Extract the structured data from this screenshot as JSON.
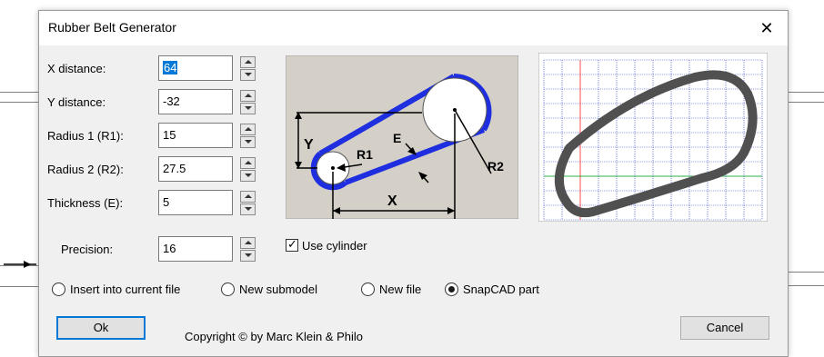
{
  "dialog": {
    "title": "Rubber Belt Generator",
    "close_glyph": "✕"
  },
  "fields": {
    "x_distance": {
      "label": "X distance:",
      "value": "64"
    },
    "y_distance": {
      "label": "Y distance:",
      "value": "-32"
    },
    "radius1": {
      "label": "Radius 1 (R1):",
      "value": "15"
    },
    "radius2": {
      "label": "Radius 2 (R2):",
      "value": "27.5"
    },
    "thickness": {
      "label": "Thickness (E):",
      "value": "5"
    },
    "precision": {
      "label": "Precision:",
      "value": "16"
    }
  },
  "diagram": {
    "label_y": "Y",
    "label_x": "X",
    "label_r1": "R1",
    "label_r2": "R2",
    "label_e": "E",
    "belt_color": "#1f2fe0",
    "background_color": "#d4d0c8"
  },
  "preview": {
    "grid_color": "#2b3fd6",
    "belt_color": "#505050",
    "axis_vertical_color": "#ff4d4d",
    "axis_horizontal_color": "#2db04a"
  },
  "options": {
    "use_cylinder": {
      "label": "Use cylinder",
      "checked": true,
      "check_glyph": "✓"
    },
    "output_mode": {
      "items": [
        {
          "label": "Insert into current file",
          "selected": false
        },
        {
          "label": "New submodel",
          "selected": false
        },
        {
          "label": "New file",
          "selected": false
        },
        {
          "label": "SnapCAD part",
          "selected": true
        }
      ]
    }
  },
  "footer": {
    "ok_label": "Ok",
    "copyright": "Copyright © by Marc Klein & Philo",
    "cancel_label": "Cancel"
  }
}
